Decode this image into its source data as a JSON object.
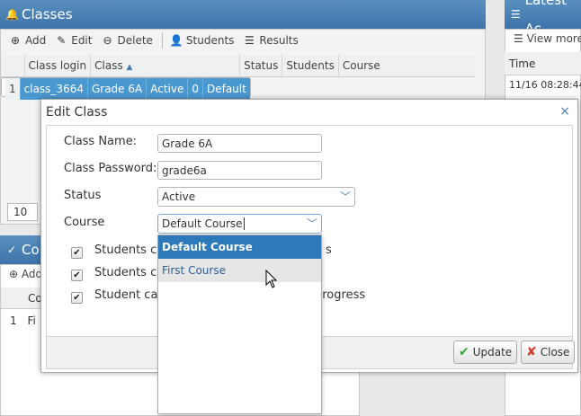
{
  "classes_panel": {
    "title": "Classes",
    "toolbar": {
      "add": "Add",
      "edit": "Edit",
      "delete": "Delete",
      "students": "Students",
      "results": "Results"
    },
    "columns": [
      "Class login",
      "Class",
      "Status",
      "Students",
      "Course"
    ],
    "rows": [
      {
        "index": "1",
        "login": "class_3664",
        "class": "Grade 6A",
        "status": "Active",
        "students": "0",
        "course": "Default"
      }
    ],
    "pager_size": "10"
  },
  "latest_panel": {
    "title": "Latest Ac",
    "view_more": "View more",
    "col_time": "Time",
    "row_time": "11/16 08:28:44"
  },
  "courses_panel": {
    "title": "Co",
    "toolbar_add": "Add",
    "col_course": "Co",
    "row_index": "1",
    "row_text": "Fi"
  },
  "dialog": {
    "title": "Edit Class",
    "close": "×",
    "class_name_label": "Class Name:",
    "class_name_value": "Grade 6A",
    "class_password_label": "Class Password:",
    "class_password_value": "grade6a",
    "status_label": "Status",
    "status_value": "Active",
    "course_label": "Course",
    "course_value": "Default Course",
    "checks": [
      {
        "text_start": "Students ca",
        "text_end": "s"
      },
      {
        "text_start": "Students ca",
        "text_end": ""
      },
      {
        "text_start": "Student ca",
        "text_end": "progress"
      }
    ],
    "course_options": [
      "Default Course",
      "First Course"
    ],
    "update_label": "Update",
    "close_label": "Close"
  },
  "colors": {
    "header_blue": "#3d73a8",
    "selection_blue": "#4a98d0",
    "dropdown_active": "#2e79b9"
  }
}
